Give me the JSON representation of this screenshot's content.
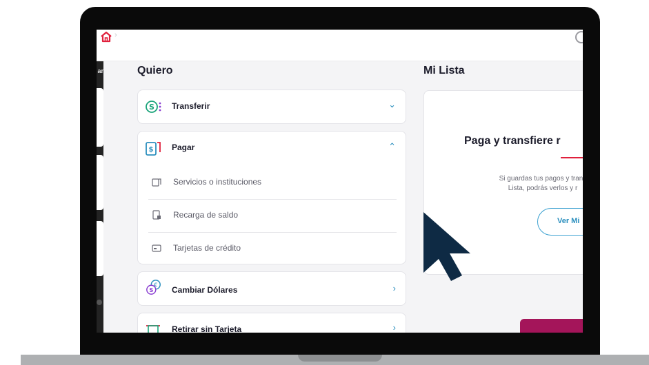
{
  "left_column": {
    "title": "Quiero",
    "cards": [
      {
        "label": "Transferir",
        "icon": "transfer-icon",
        "state": "collapsed"
      },
      {
        "label": "Pagar",
        "icon": "pay-icon",
        "state": "expanded",
        "subitems": [
          {
            "label": "Servicios o instituciones",
            "icon": "services-icon"
          },
          {
            "label": "Recarga de saldo",
            "icon": "recharge-icon"
          },
          {
            "label": "Tarjetas de crédito",
            "icon": "credit-card-icon"
          }
        ]
      },
      {
        "label": "Cambiar Dólares",
        "icon": "currency-exchange-icon",
        "state": "collapsed"
      },
      {
        "label": "Retirar sin Tarjeta",
        "icon": "cardless-withdraw-icon",
        "state": "collapsed"
      }
    ]
  },
  "right_column": {
    "title": "Mi Lista",
    "heading": "Paga y transfiere r",
    "body_line1": "Si guardas tus pagos y trans",
    "body_line2": "Lista, podrás verlos y r",
    "button_label": "Ver Mi"
  },
  "sidebar": {
    "label": "ar"
  },
  "colors": {
    "accent_red": "#e0203c",
    "accent_blue": "#2b8fbe",
    "brand_magenta": "#a4155a",
    "cursor": "#0e2a44"
  }
}
